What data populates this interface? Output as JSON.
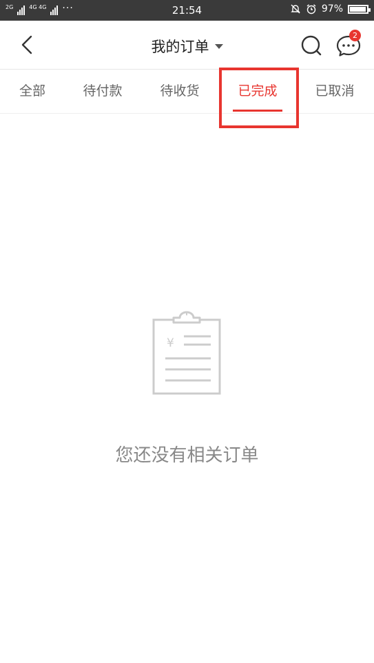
{
  "status_bar": {
    "network_left": "2G",
    "network_right": "4G 4G",
    "time": "21:54",
    "battery_percent": "97%",
    "battery_level": 0.97
  },
  "header": {
    "title": "我的订单",
    "message_badge": "2"
  },
  "tabs": [
    {
      "label": "全部",
      "active": false
    },
    {
      "label": "待付款",
      "active": false
    },
    {
      "label": "待收货",
      "active": false
    },
    {
      "label": "已完成",
      "active": true
    },
    {
      "label": "已取消",
      "active": false
    }
  ],
  "empty": {
    "text": "您还没有相关订单",
    "icon_symbol": "¥"
  },
  "colors": {
    "accent": "#e8352f",
    "status_bar": "#3a3a3a"
  }
}
